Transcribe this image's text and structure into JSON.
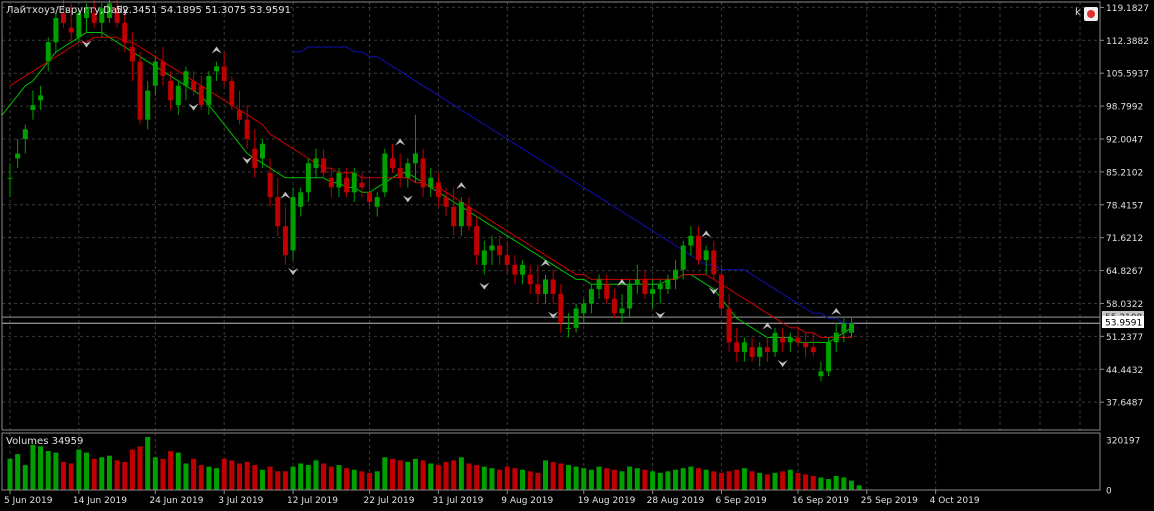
{
  "header": {
    "symbol_line": "Лайтхоуз/Евругту,Daily",
    "ohlc": "52.3451 54.1895 51.3075 53.9591"
  },
  "volume_label": "Volumes 34959",
  "current_price_label": "53.9591",
  "prev_price_label": "55.2108",
  "corner_label": "k",
  "colors": {
    "background": "#000000",
    "grid": "#3a3a3a",
    "bull": "#00a000",
    "bear": "#c00000",
    "ma_fast": "#00c000",
    "ma_mid": "#d00000",
    "ma_slow": "#1010b0",
    "axis_text": "#e0e0e0"
  },
  "chart_data": {
    "type": "candlestick",
    "title": "",
    "y_tick_labels": [
      "119.1827",
      "112.3882",
      "105.5937",
      "98.7992",
      "92.0047",
      "85.2102",
      "78.4157",
      "71.6212",
      "64.8267",
      "58.0322",
      "51.2377",
      "44.4432",
      "37.6487"
    ],
    "y_ticks": [
      119.1827,
      112.3882,
      105.5937,
      98.7992,
      92.0047,
      85.2102,
      78.4157,
      71.6212,
      64.8267,
      58.0322,
      51.2377,
      44.4432,
      37.6487
    ],
    "ylim": [
      31.9,
      120.3
    ],
    "x_tick_labels": [
      "5 Jun 2019",
      "14 Jun 2019",
      "24 Jun 2019",
      "3 Jul 2019",
      "12 Jul 2019",
      "22 Jul 2019",
      "31 Jul 2019",
      "9 Aug 2019",
      "19 Aug 2019",
      "28 Aug 2019",
      "6 Sep 2019",
      "16 Sep 2019",
      "25 Sep 2019",
      "4 Oct 2019"
    ],
    "x_tick_index": [
      0,
      9,
      19,
      28,
      37,
      47,
      56,
      65,
      75,
      84,
      93,
      103,
      112,
      121
    ],
    "volume_axis": {
      "ticks": [
        320197,
        0
      ],
      "tick_labels": [
        "320197",
        "0"
      ],
      "ylim": [
        0,
        340000
      ]
    },
    "series": [
      {
        "name": "",
        "values": [
          [
            84,
            87,
            80,
            84
          ],
          [
            88,
            92,
            86,
            89
          ],
          [
            92,
            95,
            89,
            94
          ],
          [
            98,
            102,
            96,
            99
          ],
          [
            100,
            103,
            98,
            101
          ],
          [
            108,
            113,
            106,
            112
          ],
          [
            112,
            118,
            110,
            117
          ],
          [
            118,
            122,
            115,
            116
          ],
          [
            115,
            120,
            112,
            114
          ],
          [
            113,
            119,
            112,
            118
          ],
          [
            117,
            120,
            114,
            119
          ],
          [
            118,
            121,
            115,
            116
          ],
          [
            116,
            120,
            113,
            119
          ],
          [
            117,
            121,
            116,
            120
          ],
          [
            119,
            122,
            115,
            116
          ],
          [
            116,
            118,
            110,
            112
          ],
          [
            111,
            114,
            104,
            108
          ],
          [
            108,
            110,
            95,
            96
          ],
          [
            96,
            104,
            94,
            102
          ],
          [
            103,
            109,
            101,
            108
          ],
          [
            108,
            111,
            103,
            105
          ],
          [
            104,
            106,
            98,
            100
          ],
          [
            99,
            104,
            97,
            103
          ],
          [
            103,
            107,
            100,
            106
          ],
          [
            104,
            106,
            101,
            102
          ],
          [
            103,
            105,
            98,
            99
          ],
          [
            99,
            106,
            97,
            105
          ],
          [
            106,
            108,
            104,
            107
          ],
          [
            107,
            110,
            103,
            104
          ],
          [
            104,
            105,
            98,
            99
          ],
          [
            98,
            102,
            95,
            96
          ],
          [
            96,
            99,
            90,
            92
          ],
          [
            90,
            94,
            84,
            86
          ],
          [
            88,
            92,
            86,
            91
          ],
          [
            85,
            88,
            78,
            80
          ],
          [
            80,
            84,
            72,
            74
          ],
          [
            74,
            78,
            66,
            68
          ],
          [
            69,
            82,
            67,
            80
          ],
          [
            78,
            82,
            76,
            81
          ],
          [
            81,
            88,
            79,
            87
          ],
          [
            86,
            90,
            84,
            88
          ],
          [
            88,
            90,
            84,
            85
          ],
          [
            84,
            86,
            80,
            82
          ],
          [
            82,
            86,
            80,
            85
          ],
          [
            84,
            86,
            80,
            81
          ],
          [
            81,
            86,
            79,
            85
          ],
          [
            83,
            85,
            80,
            82
          ],
          [
            81,
            84,
            78,
            79
          ],
          [
            78,
            81,
            76,
            80
          ],
          [
            81,
            90,
            80,
            89
          ],
          [
            88,
            91,
            85,
            86
          ],
          [
            86,
            89,
            82,
            84
          ],
          [
            84,
            88,
            82,
            87
          ],
          [
            87,
            97,
            83,
            89
          ],
          [
            88,
            90,
            80,
            82
          ],
          [
            82,
            86,
            80,
            84
          ],
          [
            83,
            85,
            78,
            80
          ],
          [
            80,
            82,
            76,
            78
          ],
          [
            78,
            82,
            72,
            74
          ],
          [
            74,
            80,
            72,
            79
          ],
          [
            78,
            80,
            73,
            74
          ],
          [
            74,
            76,
            66,
            68
          ],
          [
            66,
            71,
            64,
            69
          ],
          [
            69,
            72,
            66,
            70
          ],
          [
            70,
            72,
            66,
            68
          ],
          [
            68,
            71,
            64,
            66
          ],
          [
            66,
            68,
            62,
            64
          ],
          [
            64,
            67,
            62,
            66
          ],
          [
            64,
            66,
            60,
            62
          ],
          [
            62,
            66,
            58,
            60
          ],
          [
            60,
            64,
            58,
            63
          ],
          [
            63,
            65,
            58,
            60
          ],
          [
            60,
            62,
            52,
            54
          ],
          [
            53,
            56,
            51,
            53
          ],
          [
            53,
            58,
            52,
            57
          ],
          [
            56,
            59,
            54,
            58
          ],
          [
            58,
            62,
            56,
            61
          ],
          [
            61,
            64,
            59,
            63
          ],
          [
            62,
            64,
            58,
            59
          ],
          [
            59,
            61,
            55,
            56
          ],
          [
            56,
            60,
            54,
            57
          ],
          [
            57,
            63,
            55,
            62
          ],
          [
            62,
            66,
            60,
            63
          ],
          [
            63,
            65,
            59,
            60
          ],
          [
            60,
            63,
            57,
            61
          ],
          [
            61,
            63,
            58,
            62
          ],
          [
            61,
            64,
            60,
            63
          ],
          [
            63,
            67,
            61,
            65
          ],
          [
            65,
            71,
            63,
            70
          ],
          [
            70,
            74,
            68,
            72
          ],
          [
            72,
            74,
            66,
            67
          ],
          [
            67,
            70,
            64,
            69
          ],
          [
            69,
            71,
            63,
            64
          ],
          [
            64,
            66,
            55,
            57
          ],
          [
            57,
            60,
            48,
            50
          ],
          [
            50,
            53,
            46,
            48
          ],
          [
            48,
            51,
            46,
            50
          ],
          [
            49,
            51,
            46,
            47
          ],
          [
            47,
            50,
            45,
            49
          ],
          [
            49,
            51,
            46,
            48
          ],
          [
            48,
            53,
            47,
            52
          ],
          [
            51,
            53,
            48,
            50
          ],
          [
            50,
            52,
            48,
            51
          ],
          [
            51,
            53,
            49,
            50
          ],
          [
            50,
            52,
            47,
            49
          ],
          [
            49,
            52,
            47,
            48
          ],
          [
            43,
            46,
            42,
            44
          ],
          [
            44,
            51,
            43,
            50
          ],
          [
            50,
            54,
            48,
            52
          ],
          [
            52,
            55,
            50,
            54
          ],
          [
            52,
            55,
            51,
            54
          ]
        ]
      },
      {
        "name": "",
        "values": [
          97,
          99,
          101,
          103,
          104,
          106,
          108,
          110,
          111,
          112,
          113,
          114,
          114,
          114,
          113,
          112,
          111,
          110,
          109,
          108,
          107,
          106,
          105,
          104,
          103,
          102,
          101,
          99,
          97,
          95,
          93,
          91,
          89,
          88,
          87,
          86,
          85,
          84,
          84,
          84,
          84,
          84,
          84,
          83,
          83,
          82,
          82,
          81,
          81,
          82,
          83,
          84,
          85,
          85,
          84,
          83,
          82,
          81,
          80,
          79,
          78,
          77,
          76,
          75,
          74,
          73,
          72,
          71,
          70,
          69,
          68,
          67,
          66,
          65,
          64,
          63,
          63,
          62,
          62,
          62,
          62,
          62,
          62,
          62,
          62,
          62,
          62,
          63,
          63,
          64,
          64,
          63,
          62,
          61,
          59,
          57,
          55,
          54,
          53,
          52,
          51,
          51,
          51,
          51,
          50,
          50,
          50,
          50,
          50,
          51,
          52,
          53
        ]
      },
      {
        "name": "",
        "values": [
          103,
          104,
          105,
          106,
          107,
          108,
          109,
          110,
          111,
          112,
          112,
          113,
          113,
          113,
          113,
          112,
          112,
          111,
          110,
          109,
          108,
          107,
          106,
          105,
          104,
          103,
          102,
          101,
          100,
          99,
          98,
          97,
          96,
          95,
          93,
          92,
          91,
          90,
          89,
          88,
          87,
          86,
          86,
          85,
          85,
          85,
          84,
          84,
          84,
          84,
          84,
          84,
          84,
          83,
          83,
          82,
          82,
          81,
          80,
          79,
          78,
          77,
          76,
          75,
          74,
          73,
          72,
          71,
          70,
          69,
          68,
          67,
          66,
          65,
          64,
          64,
          63,
          63,
          63,
          63,
          63,
          63,
          63,
          63,
          63,
          63,
          63,
          63,
          64,
          64,
          64,
          64,
          63,
          62,
          61,
          60,
          59,
          58,
          57,
          56,
          55,
          54,
          53,
          53,
          52,
          52,
          51,
          51,
          51,
          51,
          51
        ]
      },
      {
        "name": "",
        "values": [
          110,
          110,
          111,
          111,
          111,
          111,
          111,
          111,
          110,
          110,
          109,
          109,
          108,
          107,
          106,
          105,
          104,
          103,
          102,
          101,
          100,
          99,
          98,
          97,
          96,
          95,
          94,
          93,
          92,
          91,
          90,
          89,
          88,
          87,
          86,
          85,
          84,
          83,
          82,
          81,
          80,
          79,
          78,
          77,
          76,
          75,
          74,
          73,
          72,
          71,
          70,
          69,
          68,
          67,
          66,
          66,
          65,
          65,
          65,
          65,
          64,
          63,
          62,
          61,
          60,
          59,
          58,
          57,
          56,
          56,
          55,
          55,
          54,
          54
        ]
      },
      {
        "name": "",
        "values": [
          200000,
          230000,
          160000,
          290000,
          280000,
          250000,
          240000,
          180000,
          170000,
          260000,
          240000,
          200000,
          210000,
          220000,
          190000,
          180000,
          260000,
          280000,
          340000,
          210000,
          200000,
          250000,
          240000,
          170000,
          200000,
          160000,
          150000,
          140000,
          200000,
          190000,
          170000,
          180000,
          160000,
          130000,
          150000,
          120000,
          120000,
          150000,
          170000,
          160000,
          190000,
          170000,
          150000,
          160000,
          140000,
          130000,
          120000,
          110000,
          120000,
          210000,
          200000,
          190000,
          180000,
          200000,
          190000,
          170000,
          160000,
          180000,
          190000,
          210000,
          170000,
          160000,
          150000,
          140000,
          130000,
          150000,
          140000,
          130000,
          120000,
          110000,
          190000,
          180000,
          170000,
          160000,
          150000,
          140000,
          130000,
          150000,
          140000,
          130000,
          120000,
          150000,
          140000,
          130000,
          120000,
          110000,
          120000,
          130000,
          140000,
          150000,
          140000,
          130000,
          120000,
          110000,
          120000,
          130000,
          140000,
          120000,
          110000,
          100000,
          110000,
          120000,
          130000,
          110000,
          100000,
          90000,
          80000,
          70000,
          90000,
          80000,
          60000,
          30000
        ]
      }
    ],
    "arrows_down_at": [
      10,
      24,
      31,
      37,
      52,
      62,
      71,
      85,
      92,
      101
    ],
    "arrows_up_at": [
      27,
      36,
      51,
      59,
      70,
      80,
      91,
      99,
      108
    ]
  }
}
